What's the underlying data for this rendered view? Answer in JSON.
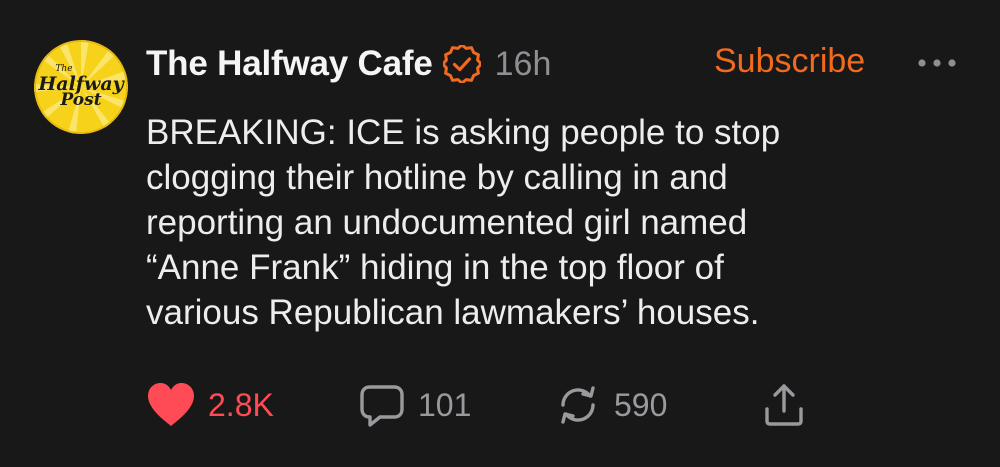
{
  "post": {
    "publication": {
      "name": "The Halfway Cafe",
      "logo_text": [
        "The",
        "Halfway",
        "Post"
      ],
      "verified": true
    },
    "timestamp": "16h",
    "subscribe_label": "Subscribe",
    "body_lines": [
      "BREAKING: ICE is asking people to stop",
      "clogging their hotline by calling in and",
      "reporting an undocumented girl named",
      "“Anne Frank” hiding in the top floor of",
      "various Republican lawmakers’ houses."
    ],
    "actions": {
      "likes": "2.8K",
      "comments": "101",
      "restacks": "590"
    }
  },
  "colors": {
    "background": "#181818",
    "accent": "#f06a1f",
    "like": "#ff4b55",
    "muted": "#8e8e93",
    "logo_yellow": "#f7d21a"
  },
  "icons": [
    "verified-badge-icon",
    "more-icon",
    "heart-icon",
    "comment-icon",
    "restack-icon",
    "share-icon"
  ]
}
